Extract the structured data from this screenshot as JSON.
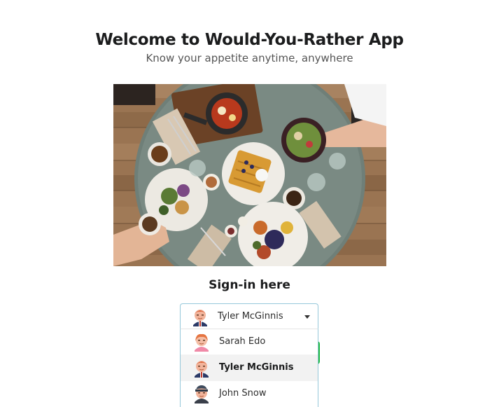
{
  "header": {
    "title": "Welcome to Would-You-Rather App",
    "subtitle": "Know your appetite anytime, anywhere"
  },
  "hero": {
    "image": "food-table-photo"
  },
  "signin": {
    "heading": "Sign-in here",
    "button_color": "#21ba45"
  },
  "user_select": {
    "selected_label": "Tyler McGinnis",
    "selected_avatar": "tyler-avatar-icon",
    "border_color": "#96c8da",
    "options": [
      {
        "label": "Sarah Edo",
        "avatar": "sarah-avatar-icon"
      },
      {
        "label": "Tyler McGinnis",
        "avatar": "tyler-avatar-icon",
        "selected": true
      },
      {
        "label": "John Snow",
        "avatar": "john-avatar-icon"
      }
    ]
  }
}
